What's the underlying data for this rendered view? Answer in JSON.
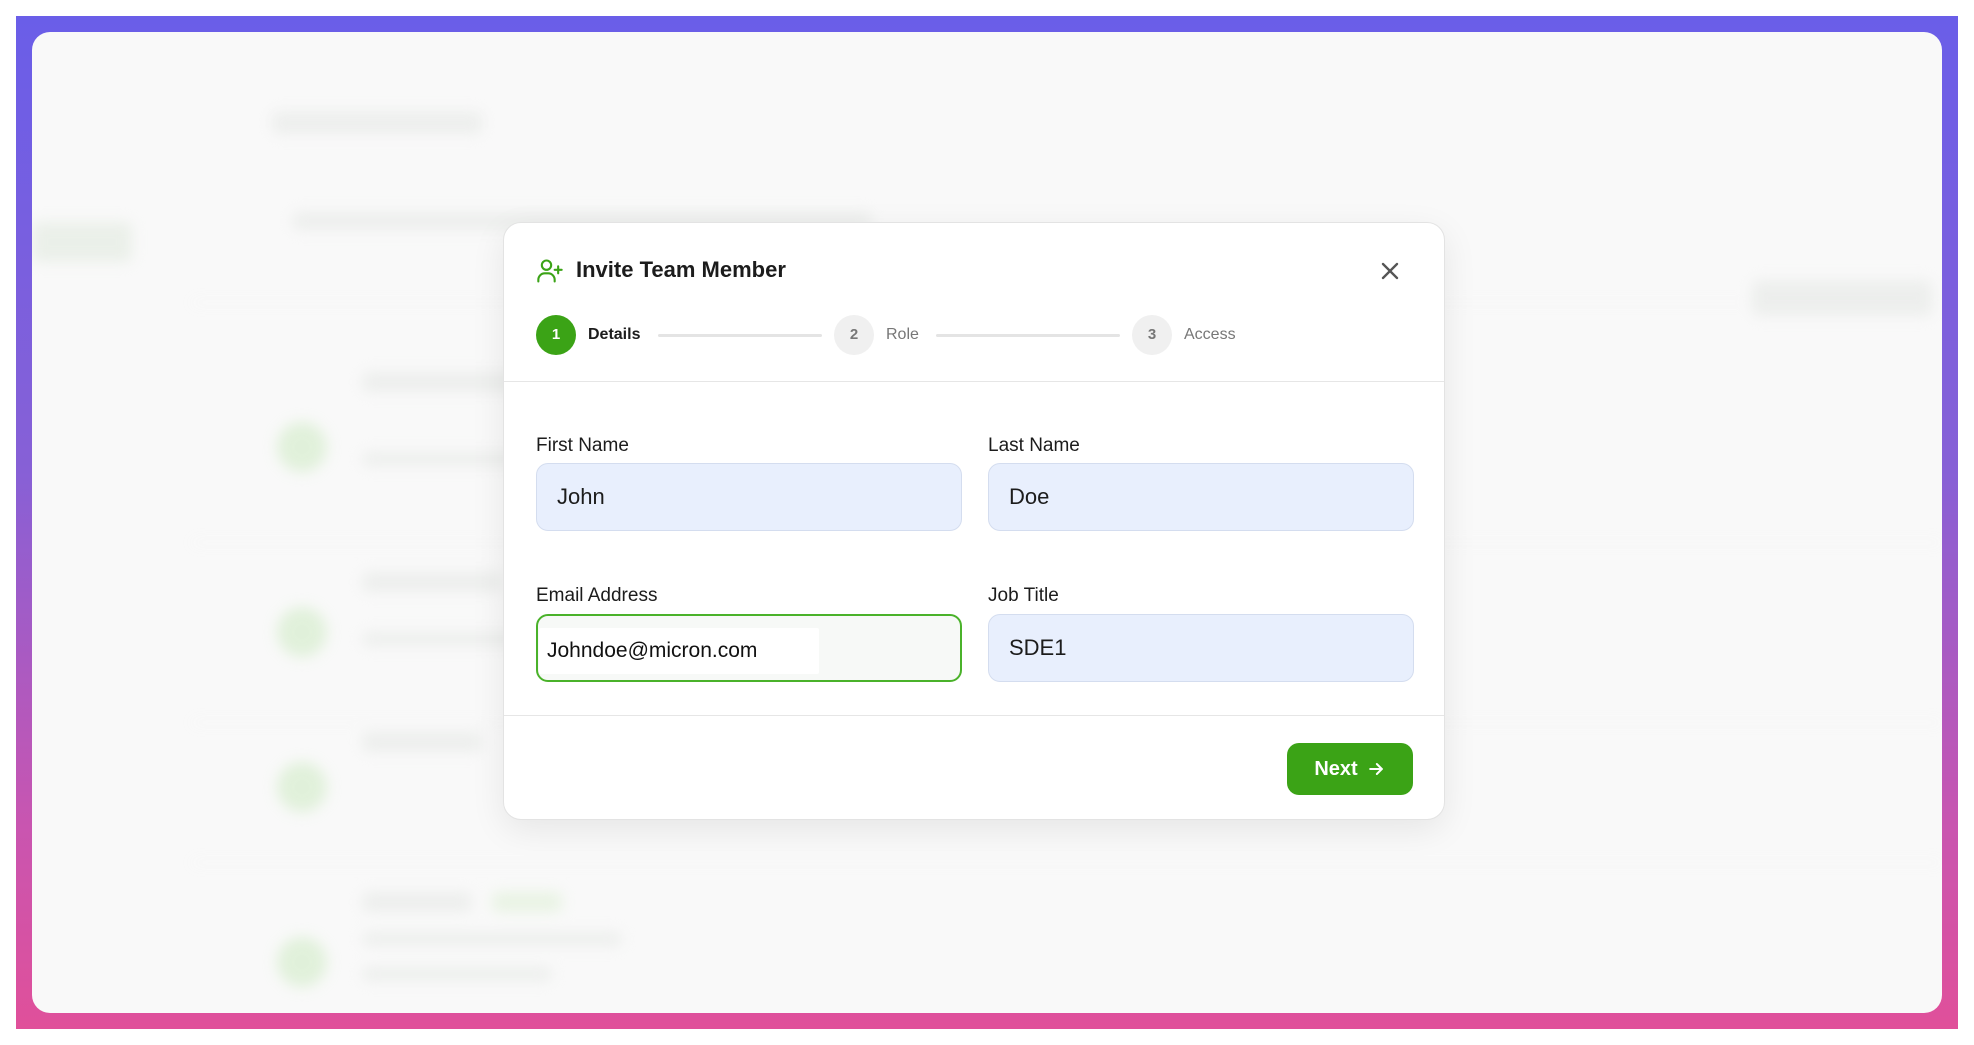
{
  "modal": {
    "title": "Invite Team Member",
    "title_icon": "user-plus-icon",
    "close_icon": "close-icon",
    "accent_color": "#3ba316"
  },
  "stepper": {
    "steps": [
      {
        "number": "1",
        "label": "Details",
        "state": "active"
      },
      {
        "number": "2",
        "label": "Role",
        "state": "inactive"
      },
      {
        "number": "3",
        "label": "Access",
        "state": "inactive"
      }
    ]
  },
  "form": {
    "first_name": {
      "label": "First Name",
      "value": "John"
    },
    "last_name": {
      "label": "Last Name",
      "value": "Doe"
    },
    "email": {
      "label": "Email Address",
      "value": "Johndoe@micron.com"
    },
    "job_title": {
      "label": "Job Title",
      "value": "SDE1"
    }
  },
  "footer": {
    "next_label": "Next",
    "next_icon": "arrow-right-icon"
  }
}
